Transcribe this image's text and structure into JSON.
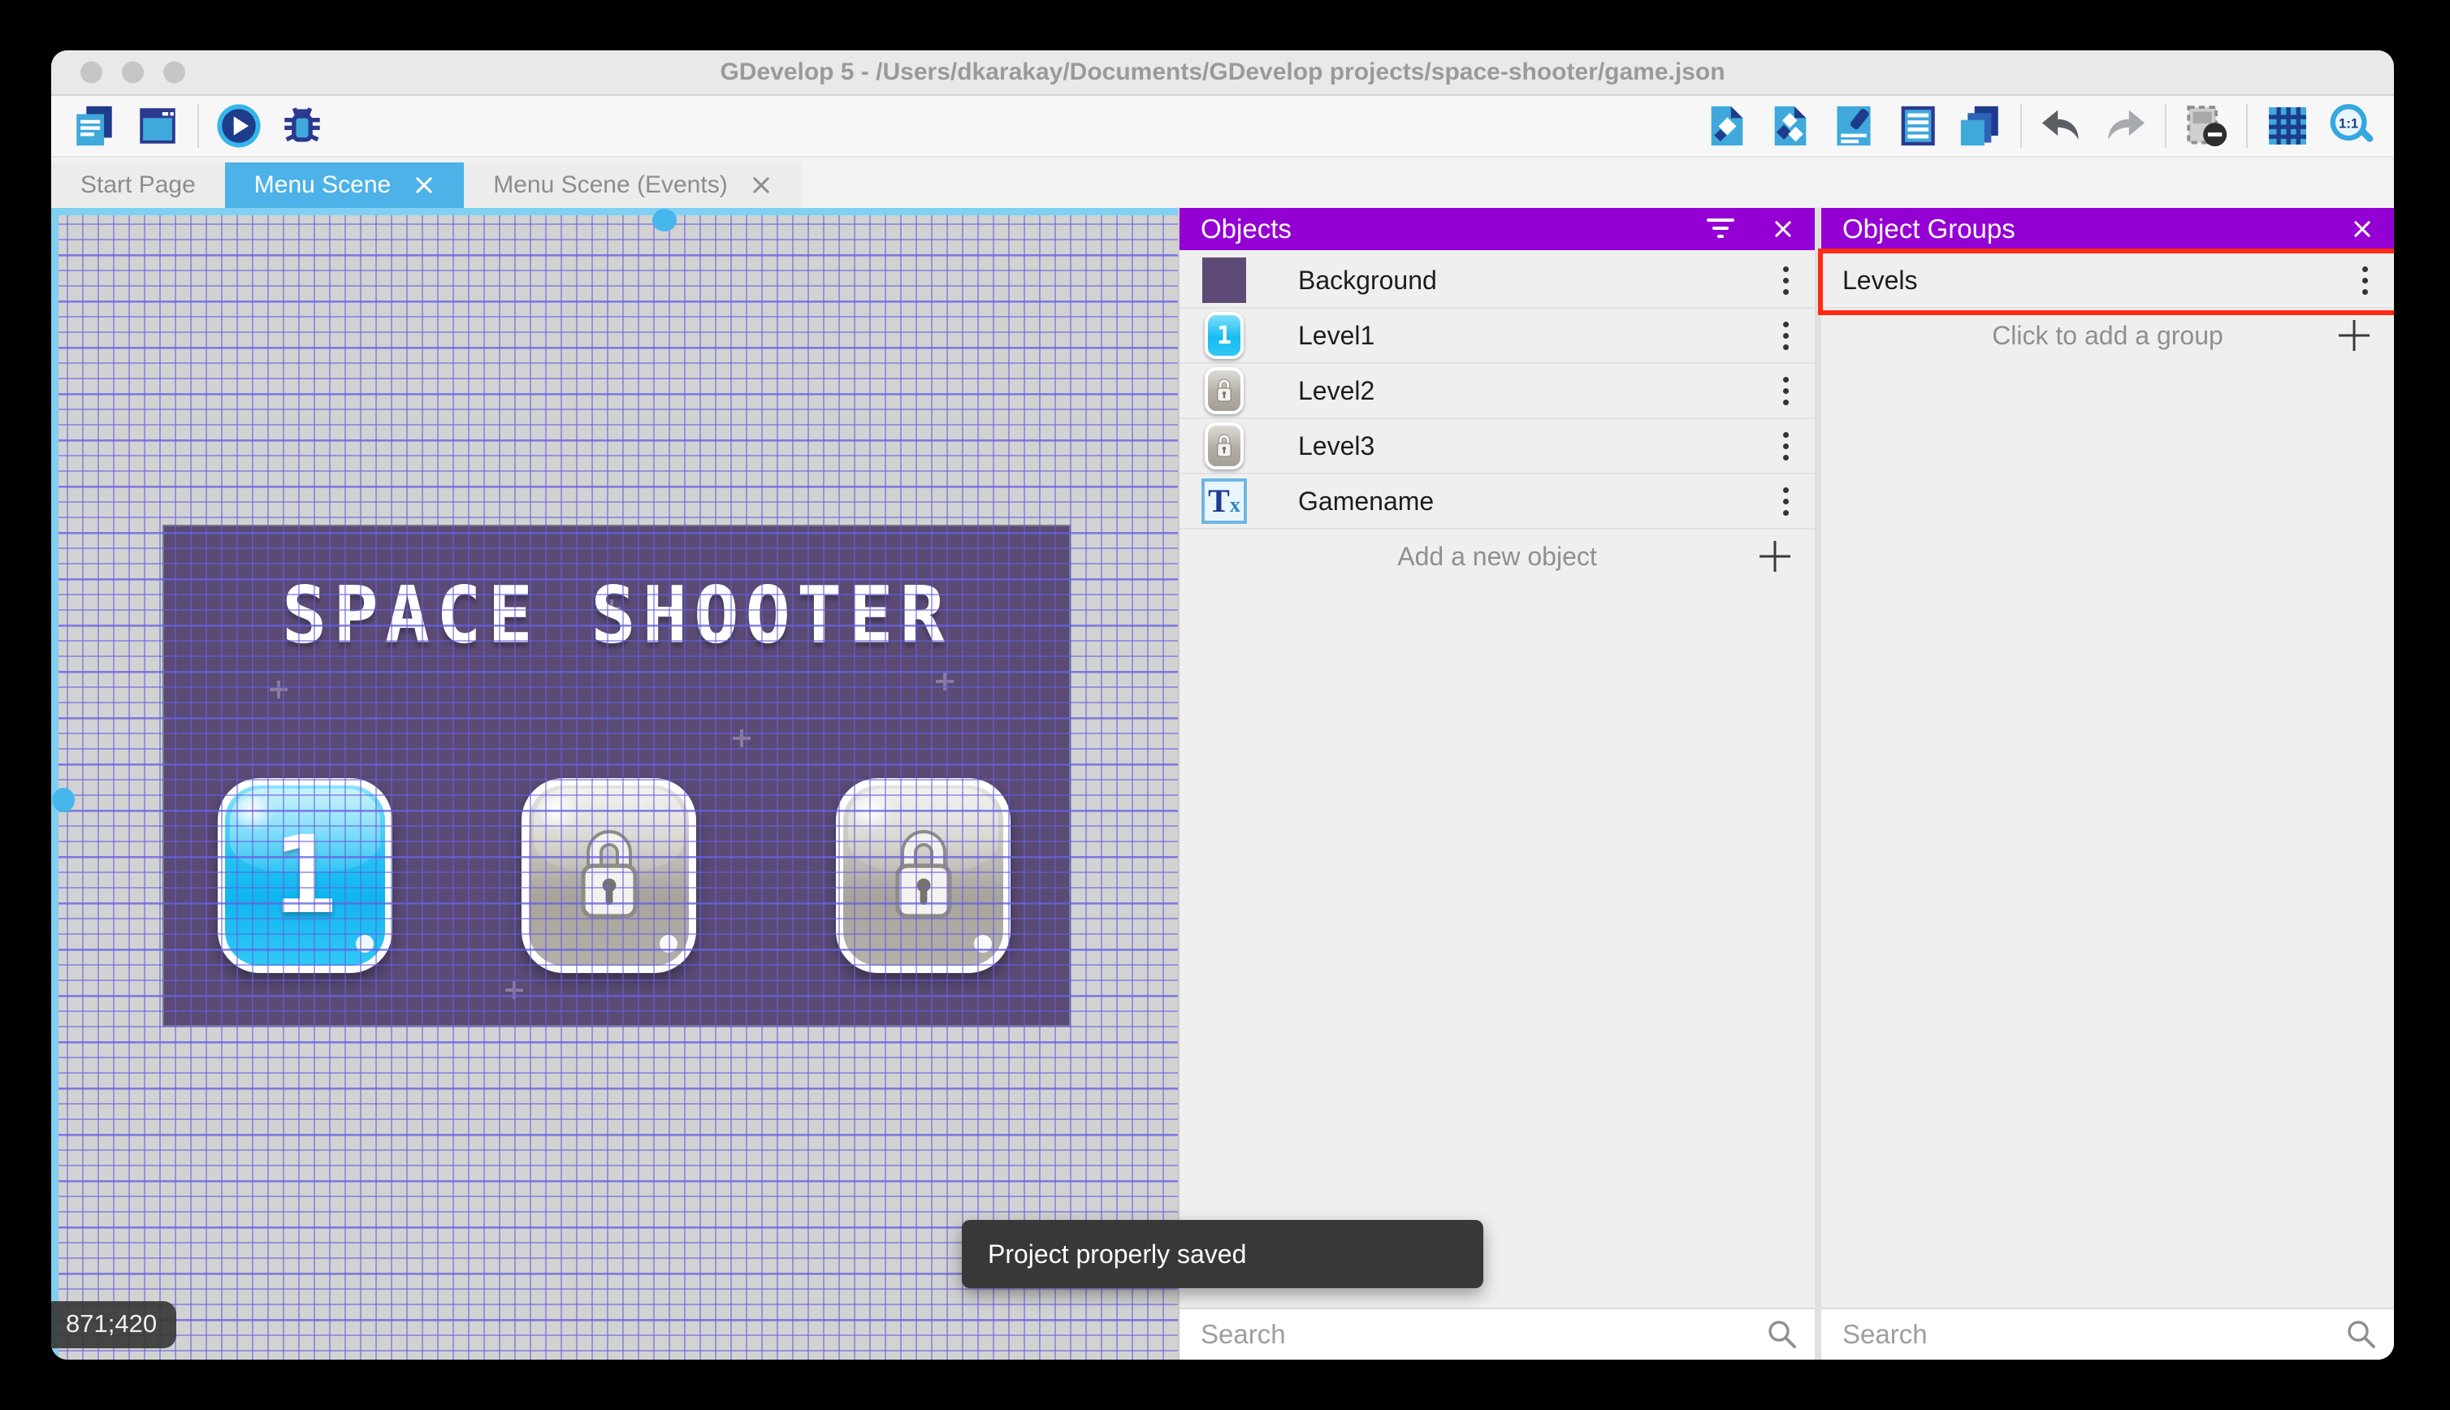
{
  "window": {
    "title": "GDevelop 5 - /Users/dkarakay/Documents/GDevelop projects/space-shooter/game.json"
  },
  "toolbar": {
    "left_icons": [
      "project-manager",
      "scene-window",
      "play-preview",
      "debug"
    ],
    "right_icons": [
      "objects-editor",
      "object-groups-editor",
      "properties",
      "instances-list",
      "layers",
      "undo",
      "redo",
      "window-mask",
      "grid",
      "zoom-1-1"
    ]
  },
  "tabs": {
    "items": [
      {
        "label": "Start Page",
        "active": false,
        "closable": false
      },
      {
        "label": "Menu Scene",
        "active": true,
        "closable": true
      },
      {
        "label": "Menu Scene (Events)",
        "active": false,
        "closable": true
      }
    ]
  },
  "scene": {
    "title_text": "SPACE SHOOTER",
    "level1_label": "1",
    "coordinates": "871;420"
  },
  "objects_panel": {
    "title": "Objects",
    "items": [
      {
        "name": "Background",
        "icon": "purple-swatch"
      },
      {
        "name": "Level1",
        "icon": "blue-level-button"
      },
      {
        "name": "Level2",
        "icon": "locked-button"
      },
      {
        "name": "Level3",
        "icon": "locked-button"
      },
      {
        "name": "Gamename",
        "icon": "text-object"
      }
    ],
    "add_label": "Add a new object",
    "search_placeholder": "Search"
  },
  "groups_panel": {
    "title": "Object Groups",
    "group_name": "Levels",
    "add_label": "Click to add a group",
    "search_placeholder": "Search"
  },
  "toast": {
    "message": "Project properly saved"
  },
  "icons": {
    "zoom_ratio_label": "1:1",
    "text_object_t": "T",
    "text_object_x": "x"
  },
  "colors": {
    "panel_header_purple": "#9400d3",
    "active_tab_blue": "#4cb2e8",
    "annotation_red": "#ff2a12",
    "scene_background": "#5a4a74",
    "grid_line": "#6561e1",
    "level_button_blue": "#19bdf2",
    "canvas_gray": "#d2d2d2",
    "toast_dark": "#383838"
  }
}
